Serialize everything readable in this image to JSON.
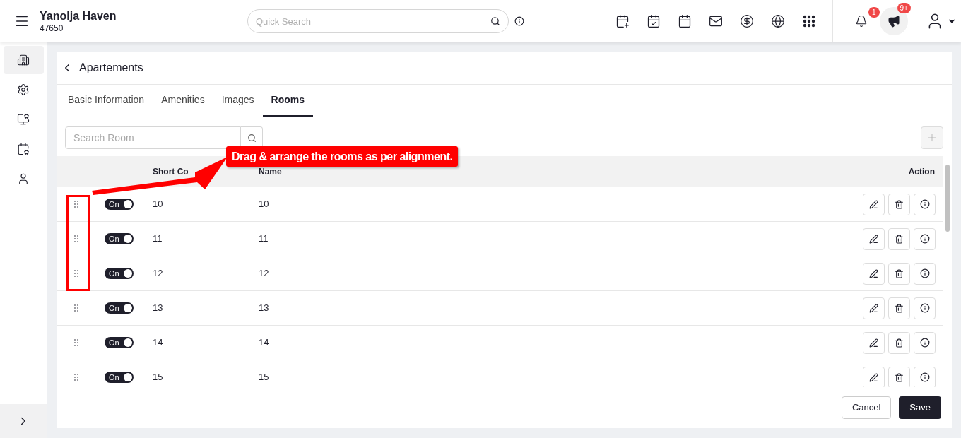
{
  "header": {
    "hotel_name": "Yanolja Haven",
    "hotel_code": "47650",
    "search": {
      "placeholder": "Quick Search"
    },
    "notification_count": "1",
    "announcement_count": "9+"
  },
  "sidebar": {
    "items": [
      {
        "kind": "building",
        "selected": true
      },
      {
        "kind": "settings",
        "selected": false
      },
      {
        "kind": "monitor",
        "selected": false
      },
      {
        "kind": "calendar",
        "selected": false
      },
      {
        "kind": "user",
        "selected": false
      }
    ]
  },
  "page": {
    "title": "Apartements",
    "tabs": [
      {
        "label": "Basic Information",
        "selected": false
      },
      {
        "label": "Amenities",
        "selected": false
      },
      {
        "label": "Images",
        "selected": false
      },
      {
        "label": "Rooms",
        "selected": true
      }
    ],
    "search": {
      "placeholder": "Search Room"
    },
    "table": {
      "columns": [
        "Short Co",
        "Name",
        "Action"
      ],
      "rows": [
        {
          "on": true,
          "toggle_label": "On",
          "short_code": "10",
          "name": "10"
        },
        {
          "on": true,
          "toggle_label": "On",
          "short_code": "11",
          "name": "11"
        },
        {
          "on": true,
          "toggle_label": "On",
          "short_code": "12",
          "name": "12"
        },
        {
          "on": true,
          "toggle_label": "On",
          "short_code": "13",
          "name": "13"
        },
        {
          "on": true,
          "toggle_label": "On",
          "short_code": "14",
          "name": "14"
        },
        {
          "on": true,
          "toggle_label": "On",
          "short_code": "15",
          "name": "15"
        }
      ]
    },
    "buttons": [
      "Cancel",
      "Save"
    ]
  },
  "annotation": {
    "text": "Drag & arrange the rooms as per alignment."
  }
}
